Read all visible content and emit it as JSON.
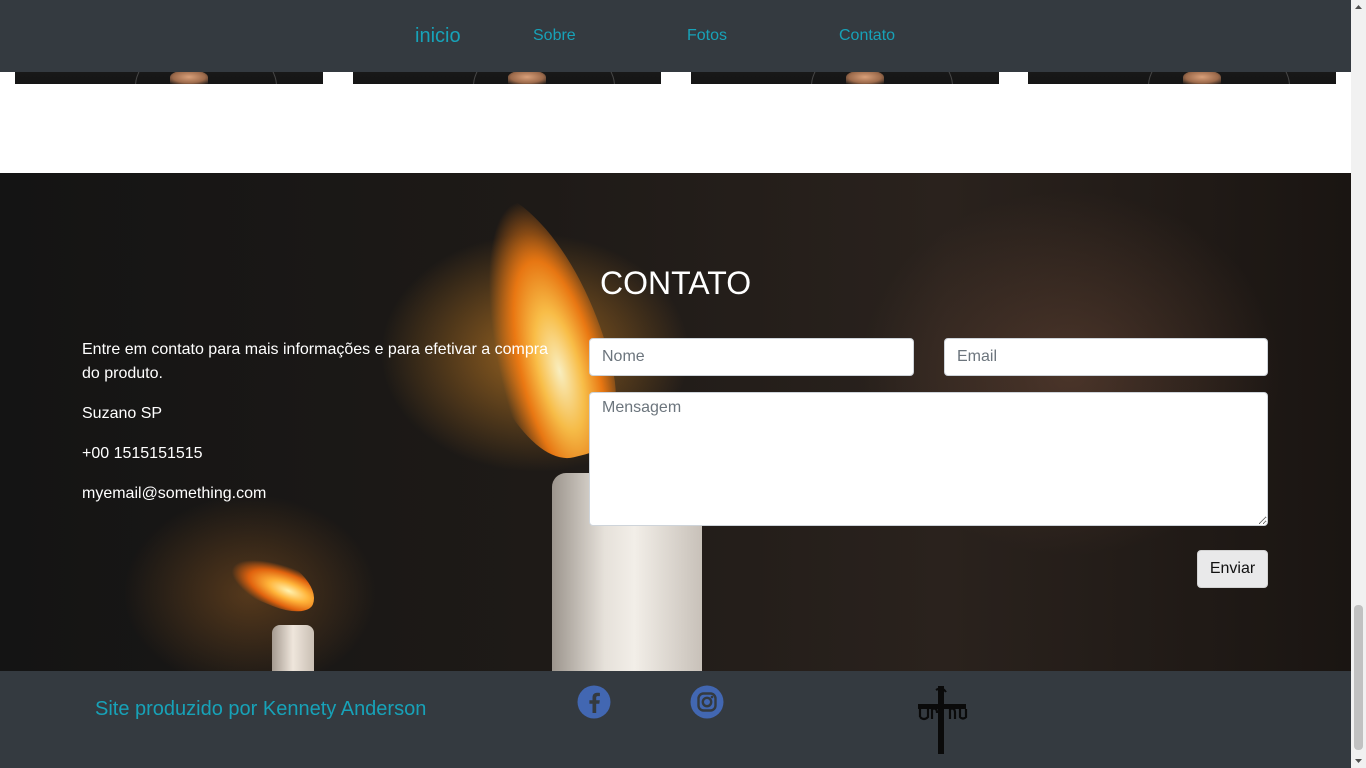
{
  "navbar": {
    "brand": "inicio",
    "links": [
      "Sobre",
      "Fotos",
      "Contato"
    ]
  },
  "gallery": {
    "thumbnails": [
      "photo",
      "photo",
      "photo",
      "photo"
    ]
  },
  "contact": {
    "title": "CONTATO",
    "intro": "Entre em contato para mais informações e para efetivar a compra do produto.",
    "location": "Suzano SP",
    "phone": "+00 1515151515",
    "email": "myemail@something.com",
    "form": {
      "name_placeholder": "Nome",
      "email_placeholder": "Email",
      "message_placeholder": "Mensagem",
      "submit_label": "Enviar"
    }
  },
  "footer": {
    "credit": "Site produzido por Kennety Anderson",
    "social_icons": [
      "facebook-icon",
      "instagram-icon"
    ],
    "logo": "cross-logo"
  },
  "colors": {
    "navbar_bg": "#343a40",
    "accent": "#17a2b8",
    "facebook": "#4267b2"
  }
}
